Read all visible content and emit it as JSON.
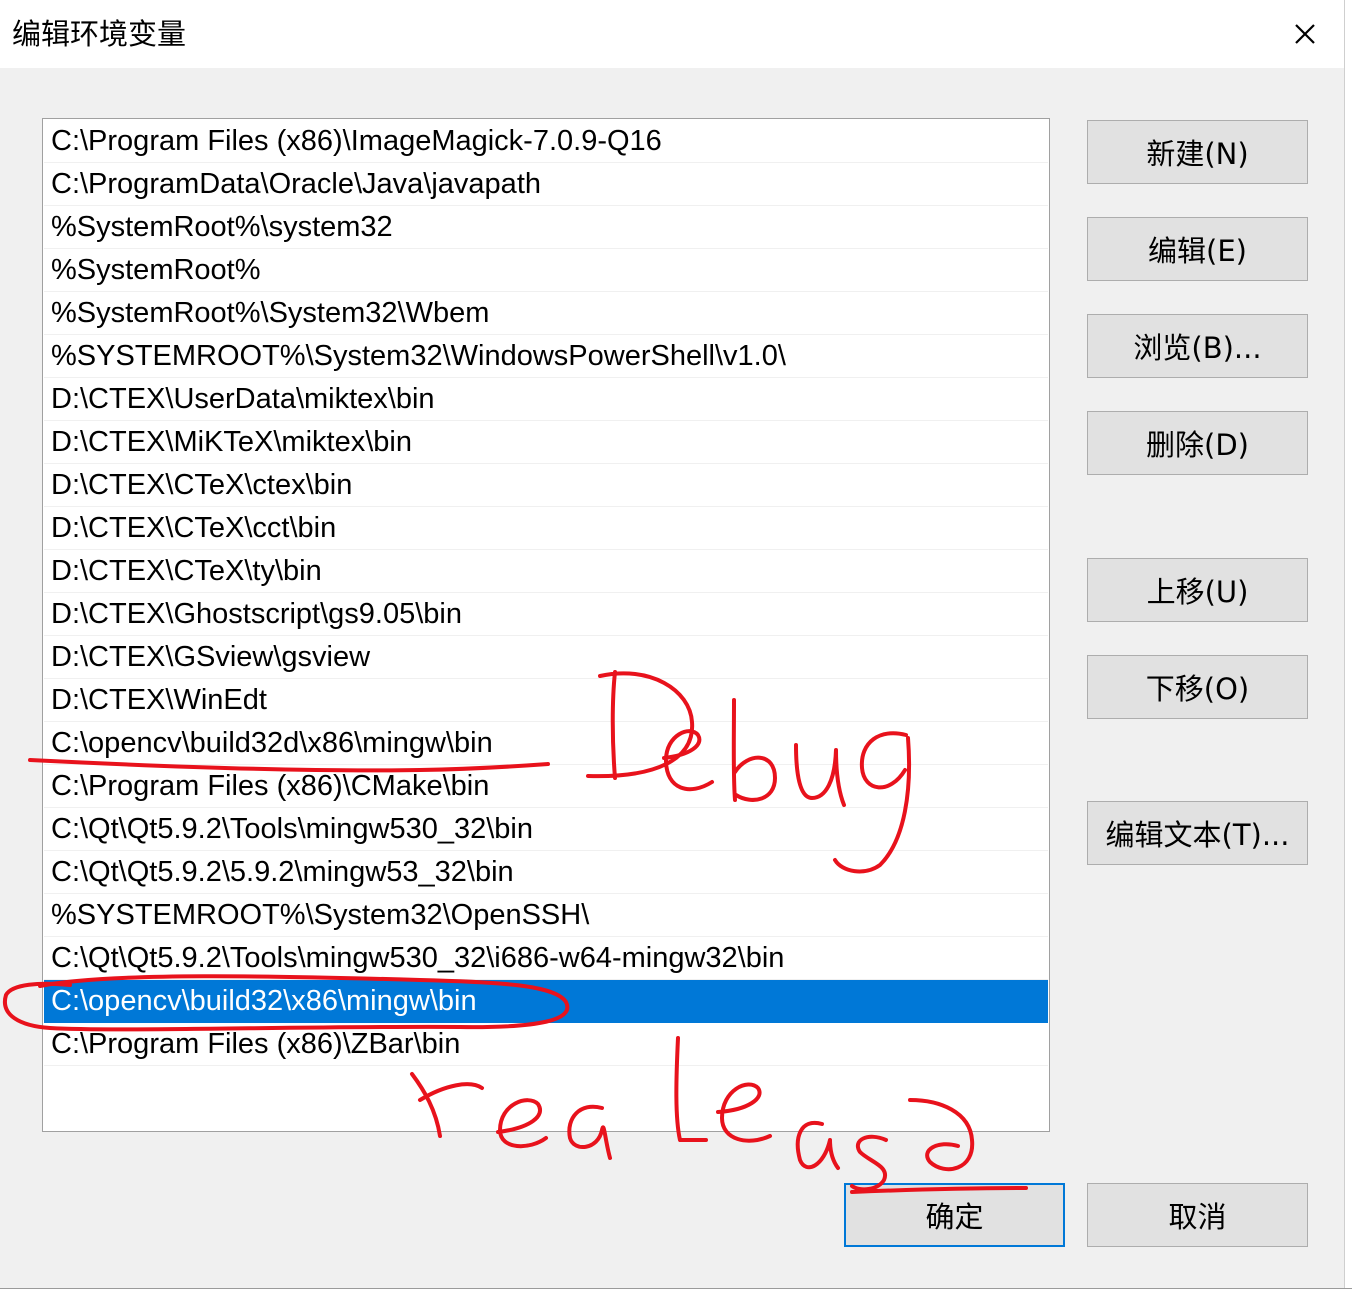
{
  "window": {
    "title": "编辑环境变量",
    "close_icon": "close-icon"
  },
  "path_list": {
    "items": [
      "C:\\Program Files (x86)\\ImageMagick-7.0.9-Q16",
      "C:\\ProgramData\\Oracle\\Java\\javapath",
      "%SystemRoot%\\system32",
      "%SystemRoot%",
      "%SystemRoot%\\System32\\Wbem",
      "%SYSTEMROOT%\\System32\\WindowsPowerShell\\v1.0\\",
      "D:\\CTEX\\UserData\\miktex\\bin",
      "D:\\CTEX\\MiKTeX\\miktex\\bin",
      "D:\\CTEX\\CTeX\\ctex\\bin",
      "D:\\CTEX\\CTeX\\cct\\bin",
      "D:\\CTEX\\CTeX\\ty\\bin",
      "D:\\CTEX\\Ghostscript\\gs9.05\\bin",
      "D:\\CTEX\\GSview\\gsview",
      "D:\\CTEX\\WinEdt",
      "C:\\opencv\\build32d\\x86\\mingw\\bin",
      "C:\\Program Files (x86)\\CMake\\bin",
      "C:\\Qt\\Qt5.9.2\\Tools\\mingw530_32\\bin",
      "C:\\Qt\\Qt5.9.2\\5.9.2\\mingw53_32\\bin",
      "%SYSTEMROOT%\\System32\\OpenSSH\\",
      "C:\\Qt\\Qt5.9.2\\Tools\\mingw530_32\\i686-w64-mingw32\\bin",
      "C:\\opencv\\build32\\x86\\mingw\\bin",
      "C:\\Program Files (x86)\\ZBar\\bin"
    ],
    "selected_index": 20
  },
  "buttons": {
    "new": "新建(N)",
    "edit": "编辑(E)",
    "browse": "浏览(B)...",
    "delete": "删除(D)",
    "move_up": "上移(U)",
    "move_down": "下移(O)",
    "edit_text": "编辑文本(T)...",
    "ok": "确定",
    "cancel": "取消"
  },
  "annotations": {
    "debug": "Debug",
    "release": "realease",
    "ink_color": "#e8121c"
  },
  "colors": {
    "selection": "#0078d7",
    "button_face": "#e1e1e1",
    "dialog_bg": "#f0f0f0"
  }
}
